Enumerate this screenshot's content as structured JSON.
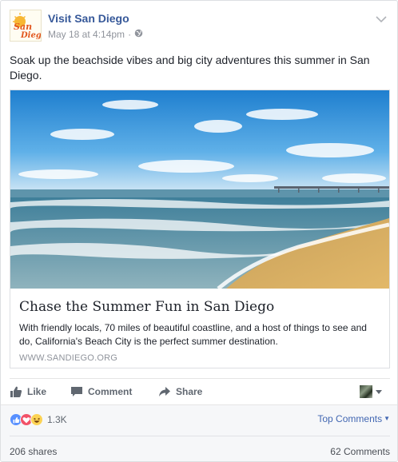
{
  "post": {
    "page_name": "Visit San Diego",
    "timestamp": "May 18 at 4:14pm",
    "separator": "·",
    "logo_text": "San Diego",
    "message": "Soak up the beachside vibes and big city adventures this summer in San Diego."
  },
  "link_card": {
    "title": "Chase the Summer Fun in San Diego",
    "description": "With friendly locals, 70 miles of beautiful coastline, and a host of things to see and do, California's Beach City is the perfect summer destination.",
    "domain": "WWW.SANDIEGO.ORG"
  },
  "actions": {
    "like": "Like",
    "comment": "Comment",
    "share": "Share"
  },
  "reactions": {
    "count": "1.3K",
    "top_comments": "Top Comments",
    "shares": "206 shares",
    "comments": "62 Comments",
    "types": [
      "like",
      "love",
      "haha"
    ]
  },
  "colors": {
    "link_blue": "#365899",
    "accent_blue": "#4267b2",
    "like_blue": "#5890ff",
    "love_red": "#f25268",
    "haha_yellow": "#fcd354"
  }
}
